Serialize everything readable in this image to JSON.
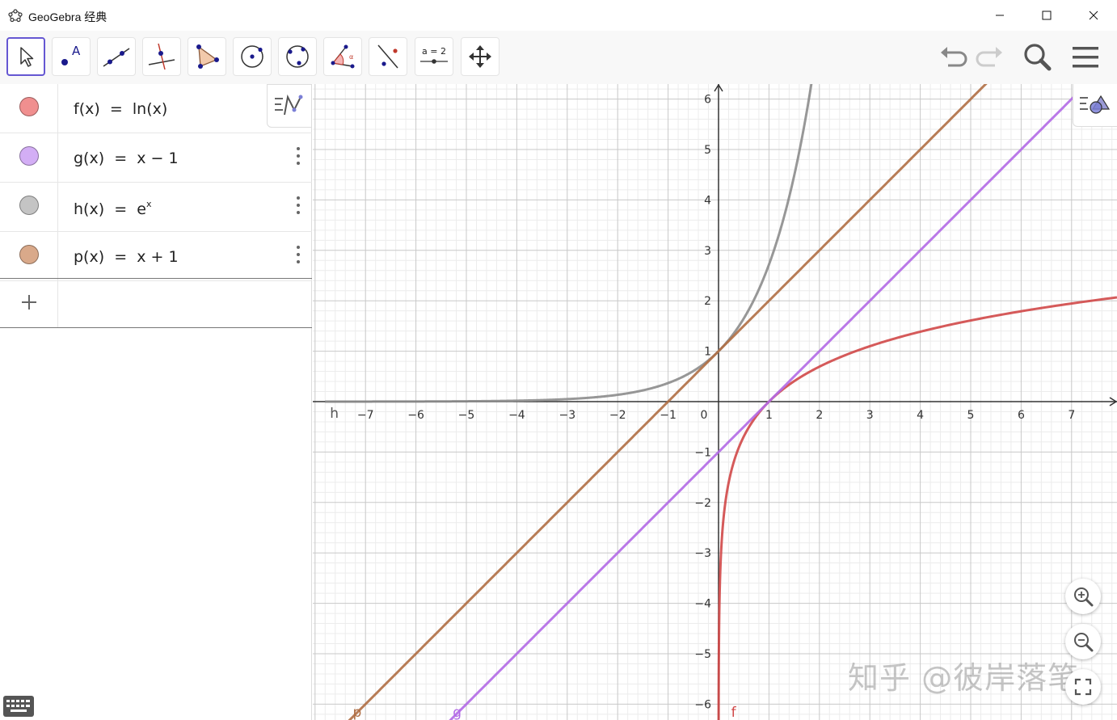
{
  "window": {
    "title": "GeoGebra 经典",
    "minimize_icon": "minimize-icon",
    "maximize_icon": "maximize-icon",
    "close_icon": "close-icon"
  },
  "toolbar": {
    "tools": [
      {
        "name": "move-tool",
        "icon": "arrow-cursor-icon",
        "selected": true
      },
      {
        "name": "point-tool",
        "icon": "point-a-icon"
      },
      {
        "name": "line-tool",
        "icon": "line-through-points-icon"
      },
      {
        "name": "perpendicular-line-tool",
        "icon": "perpendicular-line-icon"
      },
      {
        "name": "polygon-tool",
        "icon": "polygon-icon"
      },
      {
        "name": "circle-center-point-tool",
        "icon": "circle-center-icon"
      },
      {
        "name": "circle-three-points-tool",
        "icon": "circle-three-points-icon"
      },
      {
        "name": "angle-tool",
        "icon": "angle-icon"
      },
      {
        "name": "reflect-tool",
        "icon": "reflect-line-icon"
      },
      {
        "name": "slider-tool",
        "icon": "slider-icon",
        "label": "a = 2"
      },
      {
        "name": "move-graphics-view-tool",
        "icon": "move-arrows-icon"
      }
    ],
    "undo_icon": "undo-icon",
    "redo_icon": "redo-icon",
    "search_icon": "search-icon",
    "menu_icon": "hamburger-menu-icon"
  },
  "algebra": {
    "items": [
      {
        "label_lhs": "f(x)",
        "eq": "=",
        "label_rhs": "ln(x)",
        "color": "#e06666"
      },
      {
        "label_lhs": "g(x)",
        "eq": "=",
        "label_rhs": "x − 1",
        "color": "#b26ae6"
      },
      {
        "label_lhs": "h(x)",
        "eq": "=",
        "label_rhs_base": "e",
        "label_rhs_exp": "x",
        "color": "#8c8c8c"
      },
      {
        "label_lhs": "p(x)",
        "eq": "=",
        "label_rhs": "x + 1",
        "color": "#b06f45"
      }
    ],
    "input_placeholder": "",
    "add_icon": "plus-icon",
    "more_icon": "more-vertical-icon",
    "style_icon": "algebra-style-icon",
    "keyboard_icon": "keyboard-icon"
  },
  "colors": {
    "f": "#d04848",
    "g": "#b26ae6",
    "h": "#8c8c8c",
    "p": "#b06f45",
    "accent": "#6557d2"
  },
  "chart_data": {
    "type": "line",
    "title": "",
    "xlabel": "",
    "ylabel": "",
    "xlim": [
      -7.8,
      7.9
    ],
    "ylim": [
      -6.3,
      6.3
    ],
    "grid": true,
    "x_ticks": [
      -7,
      -6,
      -5,
      -4,
      -3,
      -2,
      -1,
      0,
      1,
      2,
      3,
      4,
      5,
      6,
      7
    ],
    "y_ticks": [
      -6,
      -5,
      -4,
      -3,
      -2,
      -1,
      1,
      2,
      3,
      4,
      5,
      6
    ],
    "series": [
      {
        "name": "f",
        "expr": "ln(x)",
        "points": [
          [
            0.001,
            -6.9
          ],
          [
            0.05,
            -3.0
          ],
          [
            0.2,
            -1.61
          ],
          [
            0.5,
            -0.69
          ],
          [
            1,
            0
          ],
          [
            2,
            0.69
          ],
          [
            3,
            1.1
          ],
          [
            4,
            1.39
          ],
          [
            5,
            1.61
          ],
          [
            6,
            1.79
          ],
          [
            7,
            1.95
          ],
          [
            7.9,
            2.07
          ]
        ]
      },
      {
        "name": "g",
        "expr": "x - 1",
        "points": [
          [
            -5.3,
            -6.3
          ],
          [
            7.3,
            6.3
          ]
        ]
      },
      {
        "name": "h",
        "expr": "e^x",
        "points": [
          [
            -7.8,
            0.0004
          ],
          [
            -4,
            0.018
          ],
          [
            -2,
            0.135
          ],
          [
            -1,
            0.368
          ],
          [
            0,
            1
          ],
          [
            1,
            2.718
          ],
          [
            1.5,
            4.48
          ],
          [
            1.84,
            6.3
          ]
        ]
      },
      {
        "name": "p",
        "expr": "x + 1",
        "points": [
          [
            -7.3,
            -6.3
          ],
          [
            5.3,
            6.3
          ]
        ]
      }
    ],
    "curve_labels": {
      "h": "h",
      "p": "p",
      "g": "g",
      "f": "f"
    }
  },
  "graphics": {
    "style_icon": "graphics-style-icon",
    "zoom_in_icon": "zoom-in-icon",
    "zoom_out_icon": "zoom-out-icon",
    "fullscreen_icon": "fullscreen-icon",
    "watermark": "知乎 @彼岸落笔"
  }
}
